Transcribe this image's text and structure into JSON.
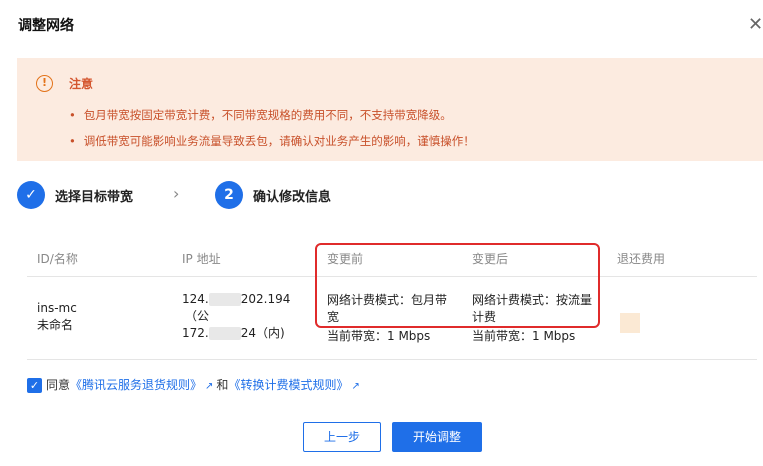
{
  "dialog": {
    "title": "调整网络",
    "close_glyph": "✕"
  },
  "notice": {
    "icon": "exclamation-circle-icon",
    "title": "注意",
    "items": [
      "包月带宽按固定带宽计费，不同带宽规格的费用不同，不支持带宽降级。",
      "调低带宽可能影响业务流量导致丢包，请确认对业务产生的影响，谨慎操作！"
    ]
  },
  "steps": [
    {
      "marker": "✓",
      "label": "选择目标带宽",
      "status": "done"
    },
    {
      "marker": "2",
      "label": "确认修改信息",
      "status": "active"
    }
  ],
  "step_separator": "›",
  "table": {
    "headers": {
      "id_name": "ID/名称",
      "ip": "IP 地址",
      "before": "变更前",
      "after": "变更后",
      "refund": "退还费用"
    },
    "row": {
      "id": "ins-mc",
      "name": "未命名",
      "ip_public_start": "124.",
      "ip_public_end": "202.194",
      "ip_public_note": "（公",
      "ip_private_start": "172.",
      "ip_private_end": "24（内)",
      "before_mode": "网络计费模式：包月带宽",
      "before_bandwidth": "当前带宽：1 Mbps",
      "after_mode": "网络计费模式：按流量计费",
      "after_bandwidth": "当前带宽：1 Mbps"
    }
  },
  "agreement": {
    "checked_glyph": "✓",
    "prefix": "同意",
    "link1": "《腾讯云服务退货规则》",
    "connector": "和",
    "link2": "《转换计费模式规则》",
    "ext_glyph": "↗"
  },
  "footer": {
    "prev_label": "上一步",
    "start_label": "开始调整"
  },
  "colors": {
    "primary": "#1f6fe8",
    "warning_bg": "#fcebe0",
    "warning_text": "#c8502a",
    "highlight_border": "#e02b2b"
  }
}
